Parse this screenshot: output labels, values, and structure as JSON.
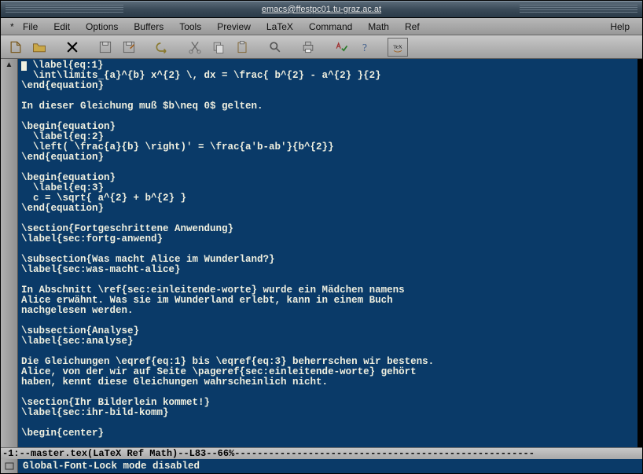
{
  "window": {
    "title": "emacs@ffestpc01.tu-graz.ac.at"
  },
  "menubar": {
    "star": "*",
    "items": [
      "File",
      "Edit",
      "Options",
      "Buffers",
      "Tools",
      "Preview",
      "LaTeX",
      "Command",
      "Math",
      "Ref"
    ],
    "help": "Help"
  },
  "toolbar": {
    "icons": [
      "open-file-icon",
      "open-folder-icon",
      "close-icon",
      "save-icon",
      "save-as-icon",
      "undo-icon",
      "cut-icon",
      "copy-icon",
      "paste-icon",
      "search-icon",
      "print-icon",
      "spell-icon",
      "help-icon",
      "tex-icon"
    ]
  },
  "buffer": {
    "lines": [
      "  \\label{eq:1}",
      "  \\int\\limits_{a}^{b} x^{2} \\, dx = \\frac{ b^{2} - a^{2} }{2}",
      "\\end{equation}",
      "",
      "In dieser Gleichung muß $b\\neq 0$ gelten.",
      "",
      "\\begin{equation}",
      "  \\label{eq:2}",
      "  \\left( \\frac{a}{b} \\right)' = \\frac{a'b-ab'}{b^{2}}",
      "\\end{equation}",
      "",
      "\\begin{equation}",
      "  \\label{eq:3}",
      "  c = \\sqrt{ a^{2} + b^{2} }",
      "\\end{equation}",
      "",
      "\\section{Fortgeschrittene Anwendung}",
      "\\label{sec:fortg-anwend}",
      "",
      "\\subsection{Was macht Alice im Wunderland?}",
      "\\label{sec:was-macht-alice}",
      "",
      "In Abschnitt \\ref{sec:einleitende-worte} wurde ein Mädchen namens",
      "Alice erwähnt. Was sie im Wunderland erlebt, kann in einem Buch",
      "nachgelesen werden.",
      "",
      "\\subsection{Analyse}",
      "\\label{sec:analyse}",
      "",
      "Die Gleichungen \\eqref{eq:1} bis \\eqref{eq:3} beherrschen wir bestens.",
      "Alice, von der wir auf Seite \\pageref{sec:einleitende-worte} gehört",
      "haben, kennt diese Gleichungen wahrscheinlich nicht.",
      "",
      "\\section{Ihr Bilderlein kommet!}",
      "\\label{sec:ihr-bild-komm}",
      "",
      "\\begin{center}"
    ]
  },
  "modeline": {
    "left": "-1:-- ",
    "buffer_name": "master.tex",
    "mode_info": "      (LaTeX Ref Math)--L83--66%",
    "dashes": "-----------------------------------------------------"
  },
  "minibuffer": {
    "text": "Global-Font-Lock mode disabled"
  }
}
